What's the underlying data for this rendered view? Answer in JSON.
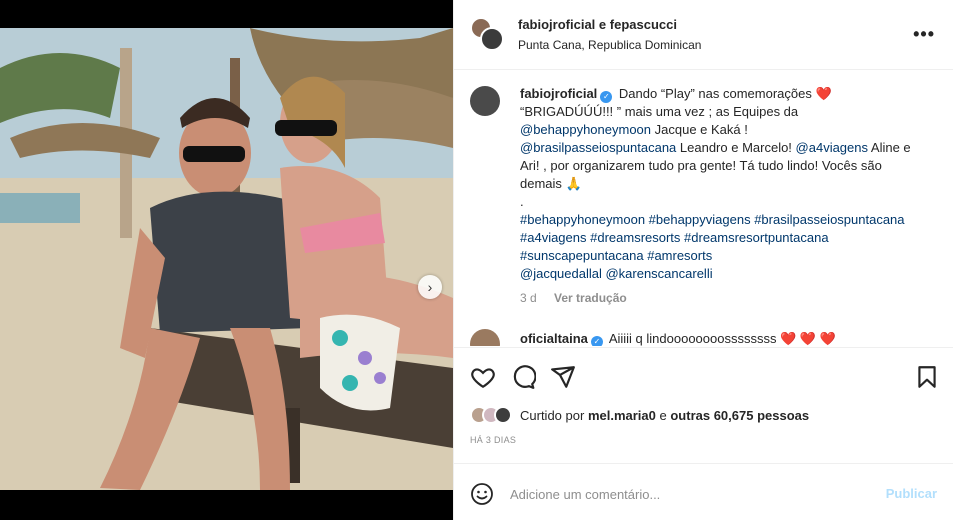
{
  "post": {
    "header": {
      "title_user1": "fabiojroficial",
      "title_and": "e",
      "title_user2": "fepascucci",
      "location": "Punta Cana, Republica Dominican"
    },
    "caption": {
      "user": "fabiojroficial",
      "line1": "Dando “Play” nas comemorações",
      "line2": "“BRIGADÚÚÚ!!! ” mais uma vez ; as Equipes da",
      "tag_behappy": "@behappyhoneymoon",
      "text_jacque": " Jacque e Kaká !",
      "tag_brasil": "@brasilpasseiospuntacana",
      "text_leandro": " Leandro e Marcelo! ",
      "tag_a4v": "@a4viagens",
      "text_aline": " Aline e Ari! , por organizarem tudo pra gente! Tá tudo lindo! Vocês são demais",
      "emoji_pray": "🙏",
      "dot": ".",
      "hashtags": "#behappyhoneymoon #behappyviagens #brasilpasseiospuntacana #a4viagens #dreamsresorts #dreamsresortpuntacana #sunscapepuntacana #amresorts",
      "mentions": "@jacquedallal @karenscancarelli",
      "heart": "❤️"
    },
    "meta": {
      "age": "3 d",
      "translate": "Ver tradução"
    },
    "comment2": {
      "user": "oficialtaina",
      "text": "Aiiiii q lindoooooooossssssss",
      "hearts": "❤️ ❤️ ❤️"
    },
    "likes": {
      "prefix": "Curtido por",
      "user": "mel.maria0",
      "middle": "e",
      "others": "outras 60,675 pessoas"
    },
    "timestamp": "HÁ 3 DIAS",
    "add_comment": {
      "placeholder": "Adicione um comentário...",
      "publish": "Publicar"
    }
  },
  "colors": {
    "link": "#00376b",
    "verified": "#3897f0",
    "publish": "#b2dffc",
    "muted": "#8e8e8e"
  },
  "icons": [
    "heart-icon",
    "comment-icon",
    "share-icon",
    "bookmark-icon",
    "emoji-icon",
    "more-icon",
    "verified-icon",
    "chevron-right-icon"
  ]
}
